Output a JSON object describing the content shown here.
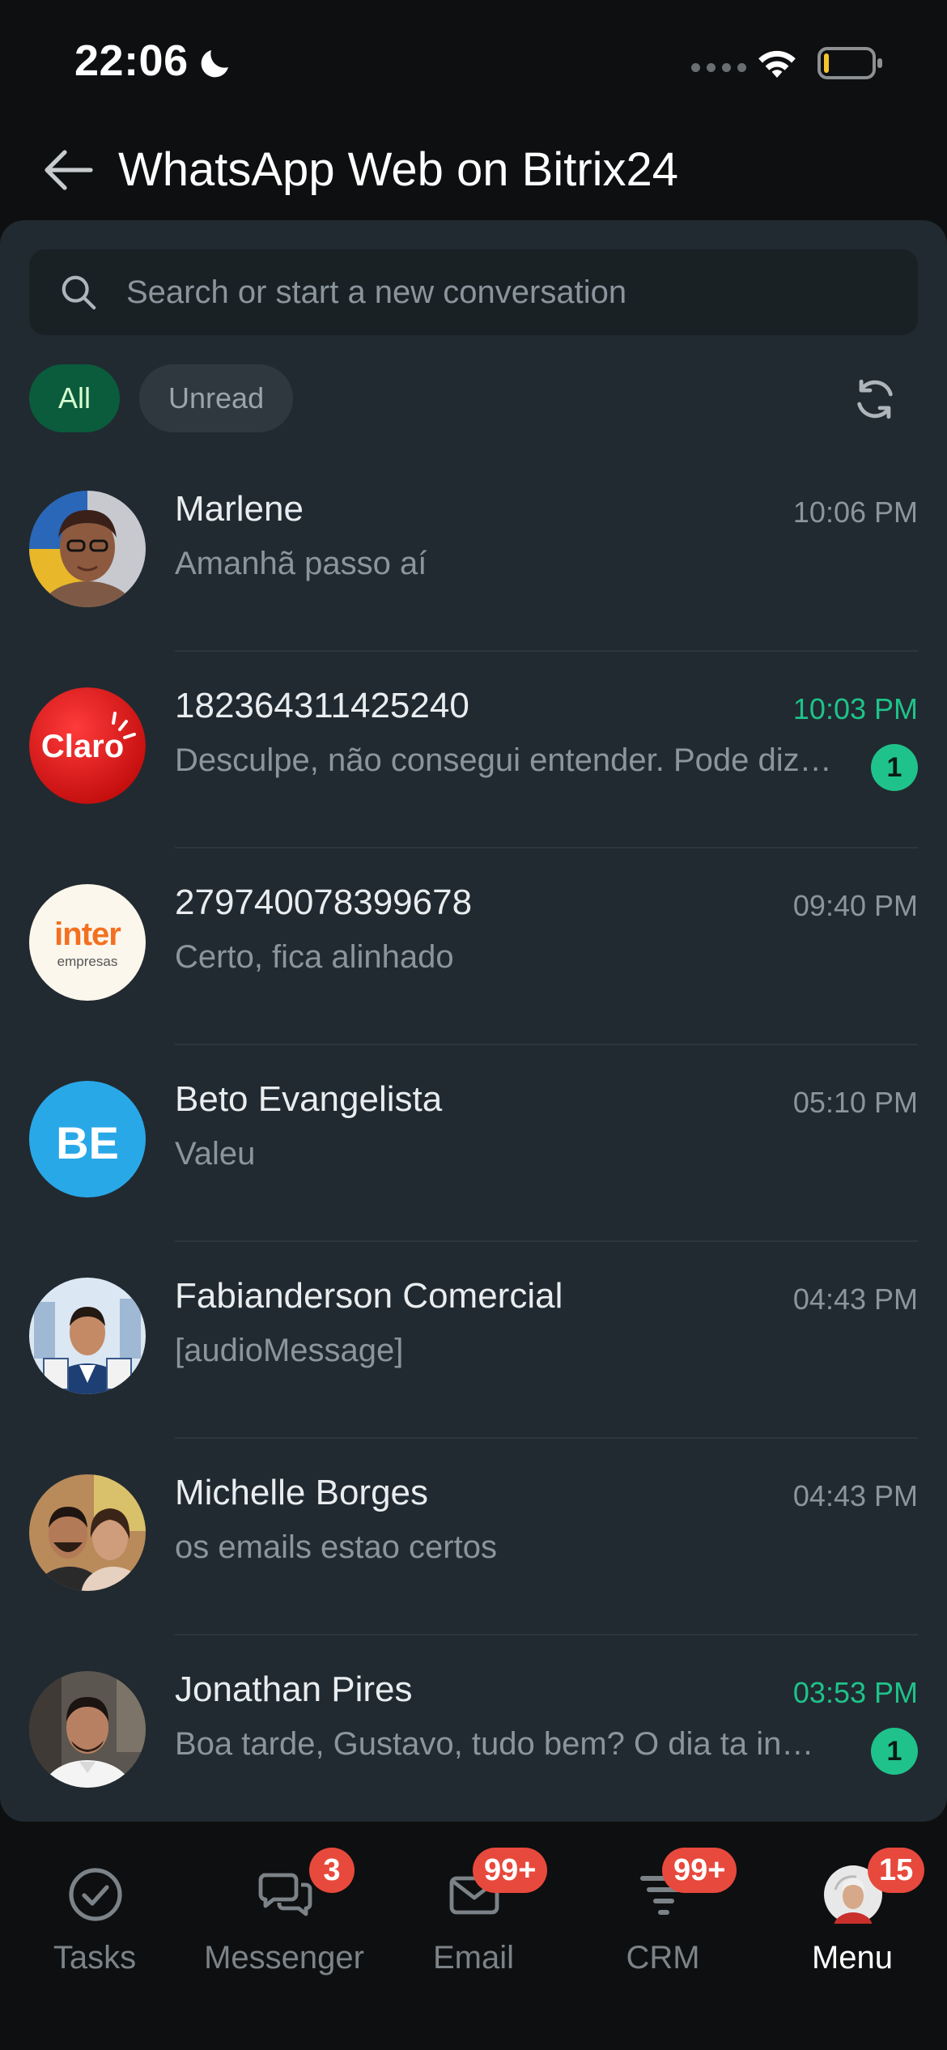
{
  "status_bar": {
    "time": "22:06"
  },
  "header": {
    "title": "WhatsApp Web on Bitrix24"
  },
  "search": {
    "placeholder": "Search or start a new conversation"
  },
  "filters": [
    {
      "label": "All",
      "active": true
    },
    {
      "label": "Unread",
      "active": false
    }
  ],
  "chats": [
    {
      "name": "Marlene",
      "time": "10:06 PM",
      "message": "Amanhã passo aí",
      "unread_count": null,
      "avatar": "photo-woman"
    },
    {
      "name": "182364311425240",
      "time": "10:03 PM",
      "message": "Desculpe, não consegui entender. Pode dizer novamente?",
      "unread_count": "1",
      "avatar": "claro-logo"
    },
    {
      "name": "279740078399678",
      "time": "09:40 PM",
      "message": "Certo, fica alinhado",
      "unread_count": null,
      "avatar": "inter-logo",
      "avatar_text": "inter",
      "avatar_subtext": "empresas"
    },
    {
      "name": "Beto Evangelista",
      "time": "05:10 PM",
      "message": "Valeu",
      "unread_count": null,
      "avatar": "initials",
      "avatar_text": "BE"
    },
    {
      "name": "Fabianderson Comercial",
      "time": "04:43 PM",
      "message": "[audioMessage]",
      "unread_count": null,
      "avatar": "photo-man-suit"
    },
    {
      "name": "Michelle Borges",
      "time": "04:43 PM",
      "message": "os emails estao certos",
      "unread_count": null,
      "avatar": "photo-couple"
    },
    {
      "name": "Jonathan Pires",
      "time": "03:53 PM",
      "message": "Boa tarde, Gustavo, tudo bem? O dia ta indo bem?",
      "unread_count": "1",
      "avatar": "photo-man"
    }
  ],
  "bottom_nav": [
    {
      "label": "Tasks",
      "icon": "check-circle-icon",
      "badge": null
    },
    {
      "label": "Messenger",
      "icon": "chat-bubbles-icon",
      "badge": "3"
    },
    {
      "label": "Email",
      "icon": "envelope-icon",
      "badge": "99+"
    },
    {
      "label": "CRM",
      "icon": "funnel-icon",
      "badge": "99+"
    },
    {
      "label": "Menu",
      "icon": "user-avatar-icon",
      "badge": "15"
    }
  ],
  "colors": {
    "accent": "#1fc28a",
    "active_chip": "#0a5c3c",
    "badge": "#e8493d",
    "panel": "#212a30"
  }
}
